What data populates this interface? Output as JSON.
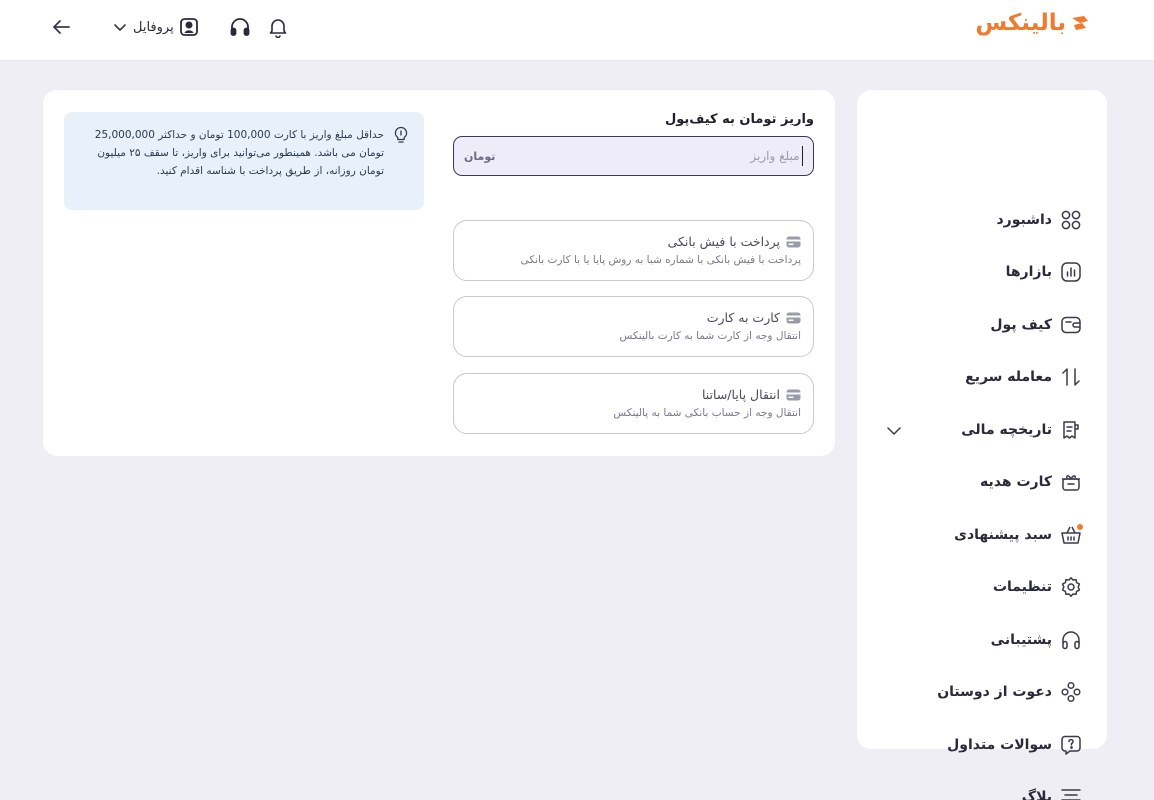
{
  "header": {
    "logo_text": "بالینکس",
    "brand_color": "#f07a2d",
    "profile_label": "پروفایل",
    "icons": [
      "back-arrow-icon",
      "chevron-down-icon",
      "user-icon",
      "headphones-icon",
      "bell-icon"
    ]
  },
  "sidebar": {
    "items": [
      {
        "label": "داشبورد",
        "icon": "grid-icon"
      },
      {
        "label": "بازارها",
        "icon": "chart-bars-icon"
      },
      {
        "label": "کیف پول",
        "icon": "wallet-icon"
      },
      {
        "label": "معامله سریع",
        "icon": "swap-arrows-icon"
      },
      {
        "label": "تاریخچه مالی",
        "icon": "receipt-icon",
        "expandable": true
      },
      {
        "label": "کارت هدیه",
        "icon": "gift-icon"
      },
      {
        "label": "سبد پیشنهادی",
        "icon": "basket-icon",
        "has_badge": true
      },
      {
        "label": "تنظیمات",
        "icon": "gear-icon"
      },
      {
        "label": "پشتیبانی",
        "icon": "headphones-icon"
      },
      {
        "label": "دعوت از دوستان",
        "icon": "users-icon"
      },
      {
        "label": "سوالات متداول",
        "icon": "question-bubble-icon"
      },
      {
        "label": "بلاگ",
        "icon": "text-lines-icon"
      }
    ]
  },
  "deposit": {
    "title": "واریز تومان به کیف‌پول",
    "amount_placeholder": "مبلغ واریز",
    "amount_value": "",
    "unit": "تومان"
  },
  "methods": [
    {
      "title": "پرداخت با فیش بانکی",
      "description": "پرداخت با فیش بانکی با شماره شبا به روش پایا یا با کارت بانکی",
      "icon": "card-icon"
    },
    {
      "title": "کارت به کارت",
      "description": "انتقال وجه از کارت شما به کارت بالینکس",
      "icon": "card-icon"
    },
    {
      "title": "انتقال پایا/ساتنا",
      "description": "انتقال وجه از حساب بانکی شما به پالینکس",
      "icon": "card-icon"
    }
  ],
  "info": {
    "text": "حداقل مبلغ واریز با کارت 100,000 تومان و حداکثر 25,000,000 تومان می باشد. همینطور می‌توانید برای واریز، تا سقف ۲۵ میلیون تومان روزانه، از طریق پرداخت با شناسه اقدام کنید.",
    "icon": "lightbulb-icon"
  }
}
